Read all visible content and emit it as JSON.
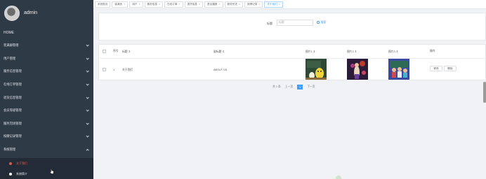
{
  "sidebar": {
    "user": "admin",
    "home": "HOME",
    "items": [
      {
        "label": "装满册管理"
      },
      {
        "label": "用户管理"
      },
      {
        "label": "服务信息管理"
      },
      {
        "label": "在线订单管理"
      },
      {
        "label": "退货信息管理"
      },
      {
        "label": "会员等级管理"
      },
      {
        "label": "服务完场管理"
      },
      {
        "label": "按摩记录管理"
      },
      {
        "label": "系统管理"
      }
    ],
    "submenu": [
      {
        "label": "关于我们",
        "active": true
      },
      {
        "label": "系统简介",
        "active": false
      }
    ]
  },
  "tabs": [
    {
      "label": "系统首页",
      "closable": false
    },
    {
      "label": "装满页",
      "closable": true
    },
    {
      "label": "用户",
      "closable": true
    },
    {
      "label": "服务信息",
      "closable": true
    },
    {
      "label": "在线订单",
      "closable": true
    },
    {
      "label": "退货信息",
      "closable": true
    },
    {
      "label": "退出播报",
      "closable": true
    },
    {
      "label": "服务完进",
      "closable": true
    },
    {
      "label": "按摩记录",
      "closable": true
    },
    {
      "label": "关于我们",
      "closable": true,
      "active": true
    }
  ],
  "search": {
    "label": "标题",
    "placeholder": "标题",
    "button": "搜索"
  },
  "table": {
    "headers": {
      "index": "序号",
      "title": "标题 ⇕",
      "subtitle": "副标题 ⇕",
      "pic1": "图片1 ⇕",
      "pic2": "图片2 ⇕",
      "pic3": "图片3 ⇕",
      "ops": "操作"
    },
    "rows": [
      {
        "index": "1",
        "title": "关于我们",
        "subtitle": "ABOUT US",
        "edit": "修改",
        "delete": "删除"
      }
    ]
  },
  "pagination": {
    "total": "共 1 条",
    "prev": "上一页",
    "current": "1",
    "next": "下一页"
  }
}
